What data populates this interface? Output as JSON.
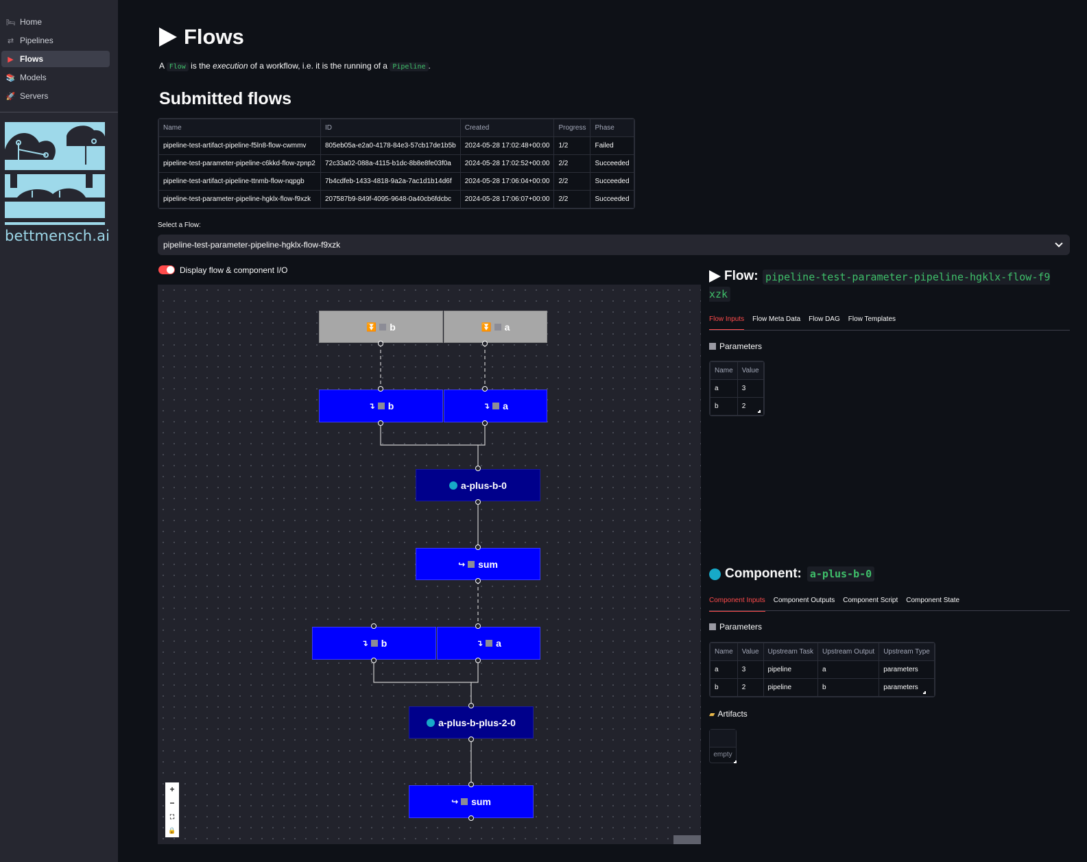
{
  "sidebar": {
    "items": [
      {
        "label": "Home",
        "icon": "bed-icon",
        "glyph": "🛏"
      },
      {
        "label": "Pipelines",
        "icon": "shuffle-icon",
        "glyph": "⇄"
      },
      {
        "label": "Flows",
        "icon": "play-icon",
        "glyph": "▶"
      },
      {
        "label": "Models",
        "icon": "books-icon",
        "glyph": "📚"
      },
      {
        "label": "Servers",
        "icon": "rocket-icon",
        "glyph": "🚀"
      }
    ],
    "active": "Flows",
    "logo_text": "bettmensch.ai"
  },
  "page": {
    "title": "Flows",
    "intro_a": "A",
    "intro_flow": "Flow",
    "intro_b": "is the",
    "intro_exec": "execution",
    "intro_c": "of a workflow, i.e. it is the running of a",
    "intro_pipeline": "Pipeline",
    "intro_d": ".",
    "submitted_heading": "Submitted flows"
  },
  "flows_table": {
    "headers": [
      "Name",
      "ID",
      "Created",
      "Progress",
      "Phase"
    ],
    "rows": [
      [
        "pipeline-test-artifact-pipeline-f5ln8-flow-cwmmv",
        "805eb05a-e2a0-4178-84e3-57cb17de1b5b",
        "2024-05-28 17:02:48+00:00",
        "1/2",
        "Failed"
      ],
      [
        "pipeline-test-parameter-pipeline-c6kkd-flow-zpnp2",
        "72c33a02-088a-4115-b1dc-8b8e8fe03f0a",
        "2024-05-28 17:02:52+00:00",
        "2/2",
        "Succeeded"
      ],
      [
        "pipeline-test-artifact-pipeline-ttnmb-flow-nqpgb",
        "7b4cdfeb-1433-4818-9a2a-7ac1d1b14d6f",
        "2024-05-28 17:06:04+00:00",
        "2/2",
        "Succeeded"
      ],
      [
        "pipeline-test-parameter-pipeline-hgklx-flow-f9xzk",
        "207587b9-849f-4095-9648-0a40cb6fdcbc",
        "2024-05-28 17:06:07+00:00",
        "2/2",
        "Succeeded"
      ]
    ]
  },
  "select_flow": {
    "label": "Select a Flow:",
    "value": "pipeline-test-parameter-pipeline-hgklx-flow-f9xzk"
  },
  "toggle": {
    "label": "Display flow & component I/O",
    "on": true,
    "color": "#ff4b4b"
  },
  "dag": {
    "nodes": {
      "in_b": "b",
      "in_a": "a",
      "p1_b": "b",
      "p1_a": "a",
      "comp1": "a-plus-b-0",
      "out1": "sum",
      "p2_b": "b",
      "p2_a": "a",
      "comp2": "a-plus-b-plus-2-0",
      "out2": "sum"
    },
    "colors": {
      "input": "#a7a7a7",
      "param": "#0000ff",
      "component": "#00008b",
      "status_dot": "#17a9c8"
    },
    "controls": [
      "+",
      "−",
      "⛶",
      "🔒"
    ]
  },
  "flow_panel": {
    "title": "Flow:",
    "flow_name": "pipeline-test-parameter-pipeline-hgklx-flow-f9xzk",
    "tabs": [
      "Flow Inputs",
      "Flow Meta Data",
      "Flow DAG",
      "Flow Templates"
    ],
    "active_tab": "Flow Inputs",
    "parameters_heading": "Parameters",
    "params_headers": [
      "Name",
      "Value"
    ],
    "params_rows": [
      [
        "a",
        "3"
      ],
      [
        "b",
        "2"
      ]
    ]
  },
  "component_panel": {
    "title": "Component:",
    "component_name": "a-plus-b-0",
    "tabs": [
      "Component Inputs",
      "Component Outputs",
      "Component Script",
      "Component State"
    ],
    "active_tab": "Component Inputs",
    "parameters_heading": "Parameters",
    "params_headers": [
      "Name",
      "Value",
      "Upstream Task",
      "Upstream Output",
      "Upstream Type"
    ],
    "params_rows": [
      [
        "a",
        "3",
        "pipeline",
        "a",
        "parameters"
      ],
      [
        "b",
        "2",
        "pipeline",
        "b",
        "parameters"
      ]
    ],
    "artifacts_heading": "Artifacts",
    "artifacts_empty": "empty"
  }
}
